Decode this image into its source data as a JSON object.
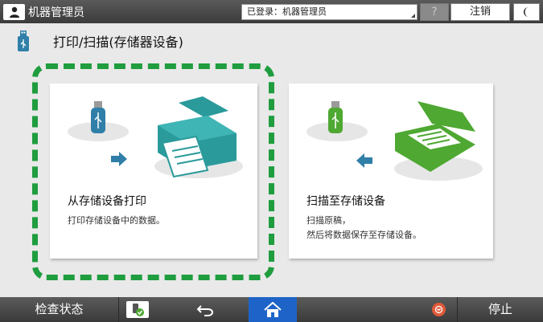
{
  "topbar": {
    "user_label": "机器管理员",
    "login_status": "已登录：机器管理员",
    "help_label": "?",
    "logout_label": "注销"
  },
  "page": {
    "title": "打印/扫描(存储器设备)"
  },
  "cards": [
    {
      "title": "从存储设备打印",
      "description_lines": [
        "打印存储设备中的数据。"
      ]
    },
    {
      "title": "扫描至存储设备",
      "description_lines": [
        "扫描原稿，",
        "然后将数据保存至存储设备。"
      ]
    }
  ],
  "bottombar": {
    "check_status_label": "检查状态",
    "stop_label": "停止"
  },
  "icons": {
    "user": "user-icon",
    "sleep": "moon-icon",
    "usb": "usb-icon",
    "printer": "printer-icon",
    "scanner": "scanner-icon",
    "app": "app-icon",
    "back": "back-arrow-icon",
    "home": "home-icon",
    "stop": "stop-icon"
  },
  "colors": {
    "focus_ring": "#1f9d3f",
    "printer": "#2a9a9b",
    "scanner": "#4ea832",
    "usb_blue": "#2f7fa8",
    "usb_green": "#4ea832",
    "home_active": "#1e64c8",
    "stop_red": "#e05a3a"
  }
}
